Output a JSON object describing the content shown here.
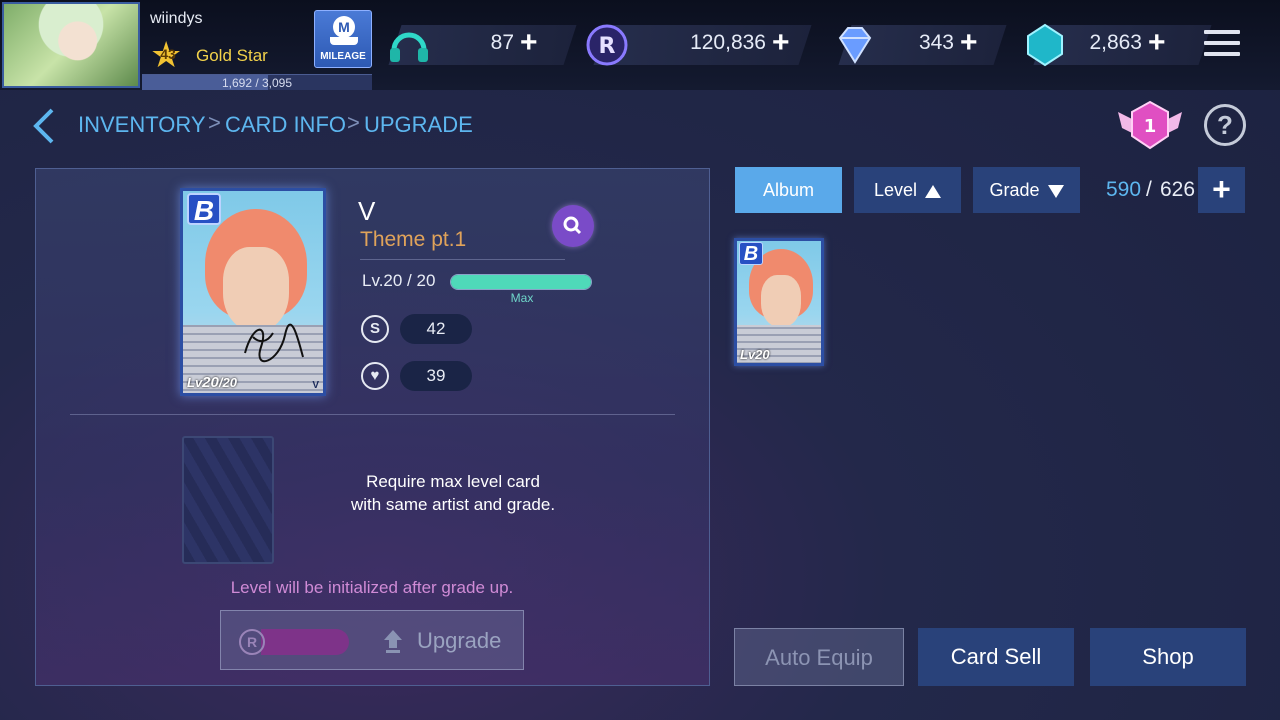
{
  "profile": {
    "username": "wiindys",
    "level": "43",
    "rank": "Gold Star",
    "xp_text": "1,692 / 3,095",
    "xp_fraction": 0.547
  },
  "mileage": {
    "label": "MILEAGE",
    "icon_letter": "M"
  },
  "currencies": [
    {
      "name": "headphone-energy",
      "value": "87"
    },
    {
      "name": "r-coin",
      "value": "120,836"
    },
    {
      "name": "diamond",
      "value": "343"
    },
    {
      "name": "crystal",
      "value": "2,863"
    }
  ],
  "plus_symbol": "+",
  "breadcrumb": {
    "items": [
      "INVENTORY",
      "CARD INFO",
      "UPGRADE"
    ],
    "separator": ">"
  },
  "gem_badge_value": "1",
  "help_symbol": "?",
  "card": {
    "grade": "B",
    "artist": "V",
    "theme": "Theme pt.1",
    "level_text": "Lv.20 / 20",
    "level_fraction": 1.0,
    "level_max_label": "Max",
    "card_lv_prefix": "Lv",
    "card_lv": "20",
    "card_lv_max": "/20",
    "card_member": "V",
    "stat_s_label": "S",
    "stat_s_value": "42",
    "stat_heart_value": "39"
  },
  "upgrade": {
    "require_line1": "Require max level card",
    "require_line2": "with same artist and grade.",
    "warning": "Level will be initialized after grade up.",
    "currency_letter": "R",
    "button_label": "Upgrade"
  },
  "sort_tabs": {
    "album": "Album",
    "level": "Level",
    "grade": "Grade"
  },
  "inventory_count": {
    "current": "590",
    "separator": "/",
    "max": "626"
  },
  "inventory_cards": [
    {
      "grade": "B",
      "lv_prefix": "Lv",
      "lv": "20"
    }
  ],
  "bottom_buttons": {
    "auto_equip": "Auto Equip",
    "card_sell": "Card Sell",
    "shop": "Shop"
  },
  "colors": {
    "accent_blue": "#5db6ef",
    "gold": "#f2d24b",
    "theme_orange": "#e0a35a",
    "warning_pink": "#d08bd6",
    "max_bar": "#4fd9b9"
  }
}
